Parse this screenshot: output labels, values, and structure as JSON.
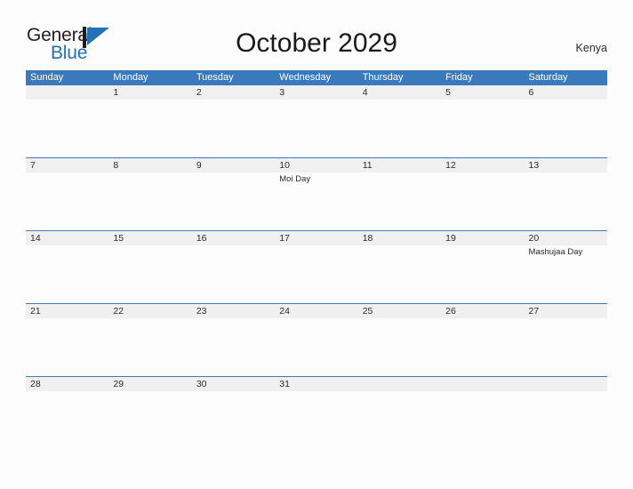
{
  "brand": {
    "name_part1": "General",
    "name_part2": "Blue",
    "logo_icon": "blue-triangle-flag-icon",
    "color_dark": "#231f20",
    "color_blue": "#2272b9"
  },
  "header": {
    "title": "October 2029",
    "region": "Kenya"
  },
  "calendar": {
    "accent_color": "#3b79bd",
    "date_band_color": "#f0f0f0",
    "weekdays": [
      "Sunday",
      "Monday",
      "Tuesday",
      "Wednesday",
      "Thursday",
      "Friday",
      "Saturday"
    ],
    "weeks": [
      {
        "days": [
          {
            "date": "",
            "event": ""
          },
          {
            "date": "1",
            "event": ""
          },
          {
            "date": "2",
            "event": ""
          },
          {
            "date": "3",
            "event": ""
          },
          {
            "date": "4",
            "event": ""
          },
          {
            "date": "5",
            "event": ""
          },
          {
            "date": "6",
            "event": ""
          }
        ]
      },
      {
        "days": [
          {
            "date": "7",
            "event": ""
          },
          {
            "date": "8",
            "event": ""
          },
          {
            "date": "9",
            "event": ""
          },
          {
            "date": "10",
            "event": "Moi Day"
          },
          {
            "date": "11",
            "event": ""
          },
          {
            "date": "12",
            "event": ""
          },
          {
            "date": "13",
            "event": ""
          }
        ]
      },
      {
        "days": [
          {
            "date": "14",
            "event": ""
          },
          {
            "date": "15",
            "event": ""
          },
          {
            "date": "16",
            "event": ""
          },
          {
            "date": "17",
            "event": ""
          },
          {
            "date": "18",
            "event": ""
          },
          {
            "date": "19",
            "event": ""
          },
          {
            "date": "20",
            "event": "Mashujaa Day"
          }
        ]
      },
      {
        "days": [
          {
            "date": "21",
            "event": ""
          },
          {
            "date": "22",
            "event": ""
          },
          {
            "date": "23",
            "event": ""
          },
          {
            "date": "24",
            "event": ""
          },
          {
            "date": "25",
            "event": ""
          },
          {
            "date": "26",
            "event": ""
          },
          {
            "date": "27",
            "event": ""
          }
        ]
      },
      {
        "days": [
          {
            "date": "28",
            "event": ""
          },
          {
            "date": "29",
            "event": ""
          },
          {
            "date": "30",
            "event": ""
          },
          {
            "date": "31",
            "event": ""
          },
          {
            "date": "",
            "event": ""
          },
          {
            "date": "",
            "event": ""
          },
          {
            "date": "",
            "event": ""
          }
        ]
      }
    ]
  }
}
